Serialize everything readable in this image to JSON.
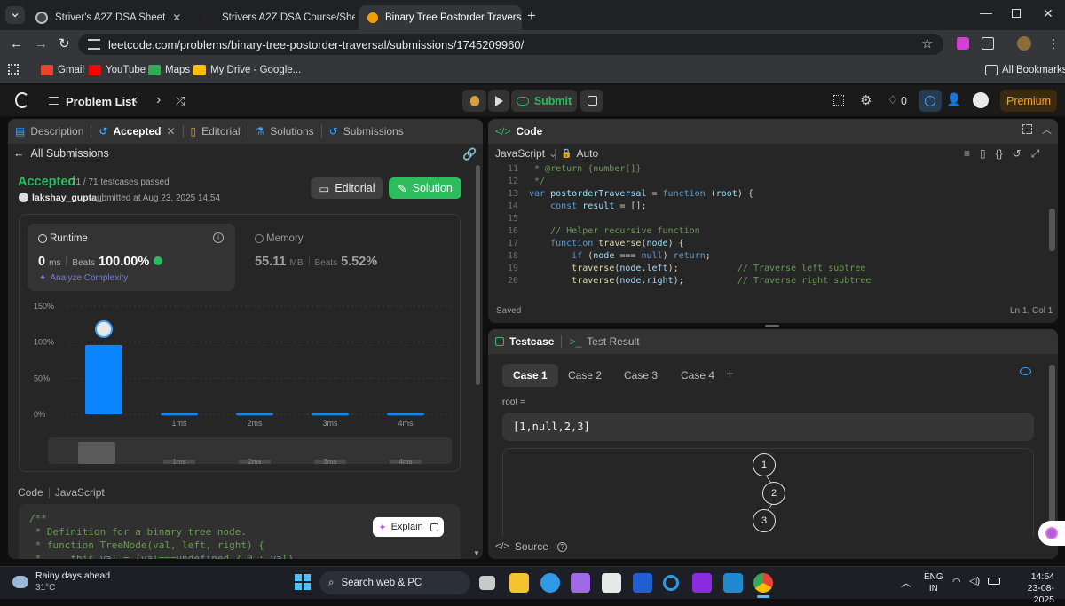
{
  "browser": {
    "tabs": [
      {
        "title": "Striver's A2Z DSA Sheet",
        "active": false
      },
      {
        "title": "Strivers A2Z DSA Course/Sheet",
        "active": false
      },
      {
        "title": "Binary Tree Postorder Traversal",
        "active": true
      }
    ],
    "url": "leetcode.com/problems/binary-tree-postorder-traversal/submissions/1745209960/",
    "bookmarks": [
      "Gmail",
      "YouTube",
      "Maps",
      "My Drive - Google..."
    ],
    "all_bookmarks": "All Bookmarks"
  },
  "topbar": {
    "problem_list": "Problem List",
    "submit": "Submit",
    "streak": "0",
    "premium": "Premium"
  },
  "left": {
    "tabs": [
      "Description",
      "Accepted",
      "Editorial",
      "Solutions",
      "Submissions"
    ],
    "back": "All Submissions",
    "status": "Accepted",
    "testcases": "71 / 71 testcases passed",
    "user": "lakshay_gupta_",
    "submitted": "submitted at Aug 23, 2025 14:54",
    "editorial_btn": "Editorial",
    "solution_btn": "Solution",
    "runtime": {
      "label": "Runtime",
      "value": "0",
      "unit": "ms",
      "beats_label": "Beats",
      "beats": "100.00%"
    },
    "memory": {
      "label": "Memory",
      "value": "55.11",
      "unit": "MB",
      "beats_label": "Beats",
      "beats": "5.52%"
    },
    "analyze": "Analyze Complexity",
    "code_label": "Code",
    "code_lang": "JavaScript",
    "explain": "Explain",
    "code": [
      {
        "cls": "cm",
        "text": "/**"
      },
      {
        "cls": "cm",
        "text": " * Definition for a binary tree node."
      },
      {
        "cls": "cm",
        "text": " * function TreeNode(val, left, right) {"
      },
      {
        "cls": "cm",
        "text": " *     this.val = (val===undefined ? 0 : val)"
      }
    ]
  },
  "chart_data": {
    "type": "bar",
    "ylabels": [
      "150%",
      "100%",
      "50%",
      "0%"
    ],
    "categories": [
      "",
      "1ms",
      "2ms",
      "3ms",
      "4ms"
    ],
    "values": [
      96,
      2,
      2,
      2,
      2
    ],
    "ylim": [
      0,
      150
    ],
    "highlight_index": 0,
    "bar_color": "#0a84ff",
    "mini_labels": [
      "1ms",
      "2ms",
      "3ms",
      "4ms"
    ]
  },
  "right": {
    "code_title": "Code",
    "lang": "JavaScript",
    "auto": "Auto",
    "saved": "Saved",
    "cursor": "Ln 1, Col 1",
    "code": [
      {
        "n": "11",
        "parts": [
          [
            "cm",
            " * @return {number[]}"
          ]
        ]
      },
      {
        "n": "12",
        "parts": [
          [
            "cm",
            " */"
          ]
        ]
      },
      {
        "n": "13",
        "parts": [
          [
            "kw",
            "var "
          ],
          [
            "va",
            "postorderTraversal"
          ],
          [
            "pl",
            " = "
          ],
          [
            "kw",
            "function"
          ],
          [
            "pl",
            " ("
          ],
          [
            "va",
            "root"
          ],
          [
            "pl",
            ") {"
          ]
        ]
      },
      {
        "n": "14",
        "parts": [
          [
            "pl",
            "    "
          ],
          [
            "kw",
            "const "
          ],
          [
            "va",
            "result"
          ],
          [
            "pl",
            " = [];"
          ]
        ]
      },
      {
        "n": "15",
        "parts": [
          [
            "pl",
            ""
          ]
        ]
      },
      {
        "n": "16",
        "parts": [
          [
            "pl",
            "    "
          ],
          [
            "cm",
            "// Helper recursive function"
          ]
        ]
      },
      {
        "n": "17",
        "parts": [
          [
            "pl",
            "    "
          ],
          [
            "kw",
            "function "
          ],
          [
            "fn",
            "traverse"
          ],
          [
            "pl",
            "("
          ],
          [
            "va",
            "node"
          ],
          [
            "pl",
            ") {"
          ]
        ]
      },
      {
        "n": "18",
        "parts": [
          [
            "pl",
            "        "
          ],
          [
            "kw",
            "if"
          ],
          [
            "pl",
            " ("
          ],
          [
            "va",
            "node"
          ],
          [
            "pl",
            " === "
          ],
          [
            "kw",
            "null"
          ],
          [
            "pl",
            ") "
          ],
          [
            "kw",
            "return"
          ],
          [
            "pl",
            ";"
          ]
        ]
      },
      {
        "n": "19",
        "parts": [
          [
            "pl",
            "        "
          ],
          [
            "fn",
            "traverse"
          ],
          [
            "pl",
            "("
          ],
          [
            "va",
            "node"
          ],
          [
            "pl",
            "."
          ],
          [
            "va",
            "left"
          ],
          [
            "pl",
            ");           "
          ],
          [
            "cm",
            "// Traverse left subtree"
          ]
        ]
      },
      {
        "n": "20",
        "parts": [
          [
            "pl",
            "        "
          ],
          [
            "fn",
            "traverse"
          ],
          [
            "pl",
            "("
          ],
          [
            "va",
            "node"
          ],
          [
            "pl",
            "."
          ],
          [
            "va",
            "right"
          ],
          [
            "pl",
            ");          "
          ],
          [
            "cm",
            "// Traverse right subtree"
          ]
        ]
      }
    ],
    "testcase_tab": "Testcase",
    "result_tab": "Test Result",
    "cases": [
      "Case 1",
      "Case 2",
      "Case 3",
      "Case 4"
    ],
    "param_label": "root =",
    "param_value": "[1,null,2,3]",
    "tree_nodes": [
      "1",
      "2",
      "3"
    ],
    "source": "Source"
  },
  "taskbar": {
    "weather": "Rainy days ahead",
    "temp": "31°C",
    "search": "Search web & PC",
    "lang1": "ENG",
    "lang2": "IN",
    "time": "14:54",
    "date": "23-08-2025"
  }
}
